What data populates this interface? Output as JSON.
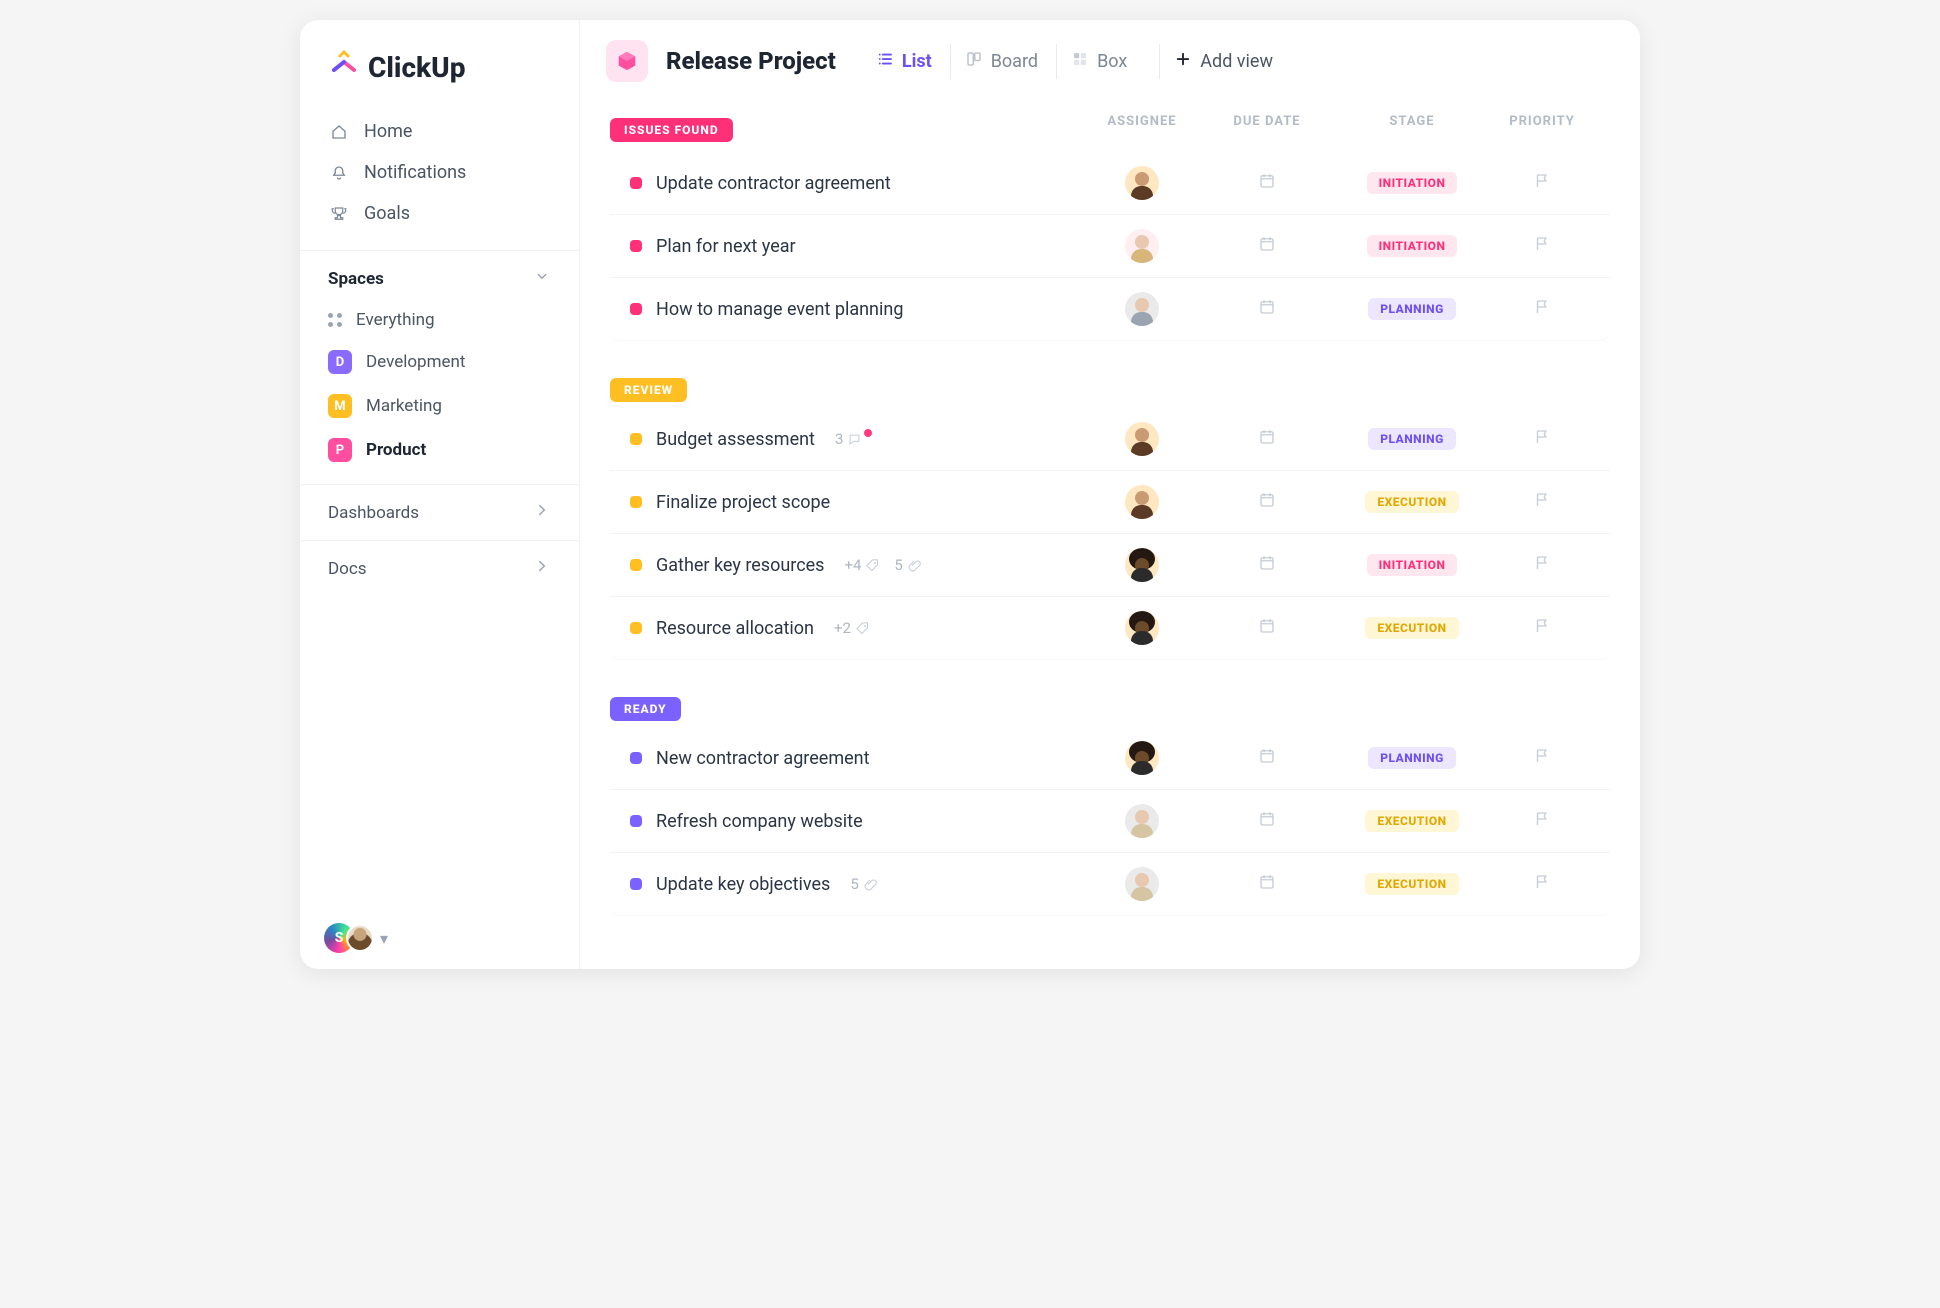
{
  "brand": "ClickUp",
  "sidebar": {
    "nav": [
      {
        "icon": "home-icon",
        "label": "Home"
      },
      {
        "icon": "bell-icon",
        "label": "Notifications"
      },
      {
        "icon": "trophy-icon",
        "label": "Goals"
      }
    ],
    "spaces_header": "Spaces",
    "everything_label": "Everything",
    "spaces": [
      {
        "letter": "D",
        "label": "Development",
        "color": "#8a6bff",
        "active": false
      },
      {
        "letter": "M",
        "label": "Marketing",
        "color": "#ffbf23",
        "active": false
      },
      {
        "letter": "P",
        "label": "Product",
        "color": "#ff4ea0",
        "active": true
      }
    ],
    "sections": [
      {
        "label": "Dashboards"
      },
      {
        "label": "Docs"
      }
    ],
    "footer_avatar_letter": "S"
  },
  "header": {
    "project_title": "Release Project",
    "views": [
      {
        "icon": "list-icon",
        "label": "List",
        "active": true
      },
      {
        "icon": "board-icon",
        "label": "Board",
        "active": false
      },
      {
        "icon": "box-icon",
        "label": "Box",
        "active": false
      }
    ],
    "add_view_label": "Add view"
  },
  "columns": [
    "ASSIGNEE",
    "DUE DATE",
    "STAGE",
    "PRIORITY"
  ],
  "stage_styles": {
    "INITIATION": {
      "bg": "#ffe6ef",
      "fg": "#ff2f78"
    },
    "PLANNING": {
      "bg": "#ece7ff",
      "fg": "#6c4ff6"
    },
    "EXECUTION": {
      "bg": "#fff6d6",
      "fg": "#e0a800"
    }
  },
  "groups": [
    {
      "name": "ISSUES FOUND",
      "color": "#ff2f78",
      "tasks": [
        {
          "title": "Update contractor agreement",
          "stage": "INITIATION",
          "avatar": 0
        },
        {
          "title": "Plan for next year",
          "stage": "INITIATION",
          "avatar": 1
        },
        {
          "title": "How to manage event planning",
          "stage": "PLANNING",
          "avatar": 2
        }
      ]
    },
    {
      "name": "REVIEW",
      "color": "#ffbf23",
      "tasks": [
        {
          "title": "Budget assessment",
          "stage": "PLANNING",
          "avatar": 0,
          "comments": 3,
          "comment_unread": true
        },
        {
          "title": "Finalize project scope",
          "stage": "EXECUTION",
          "avatar": 0
        },
        {
          "title": "Gather key resources",
          "stage": "INITIATION",
          "avatar": 3,
          "tags": 4,
          "attachments": 5
        },
        {
          "title": "Resource allocation",
          "stage": "EXECUTION",
          "avatar": 3,
          "tags": 2
        }
      ]
    },
    {
      "name": "READY",
      "color": "#7b61ff",
      "tasks": [
        {
          "title": "New contractor agreement",
          "stage": "PLANNING",
          "avatar": 3
        },
        {
          "title": "Refresh company website",
          "stage": "EXECUTION",
          "avatar": 4
        },
        {
          "title": "Update key objectives",
          "stage": "EXECUTION",
          "avatar": 4,
          "attachments": 5
        }
      ]
    }
  ],
  "avatars": [
    {
      "cls": "av-bg-0",
      "variant": "default"
    },
    {
      "cls": "av-bg-1",
      "variant": "blonde"
    },
    {
      "cls": "av-bg-2",
      "variant": "grey"
    },
    {
      "cls": "av-bg-0",
      "variant": "afro"
    },
    {
      "cls": "av-bg-2",
      "variant": "light"
    }
  ]
}
